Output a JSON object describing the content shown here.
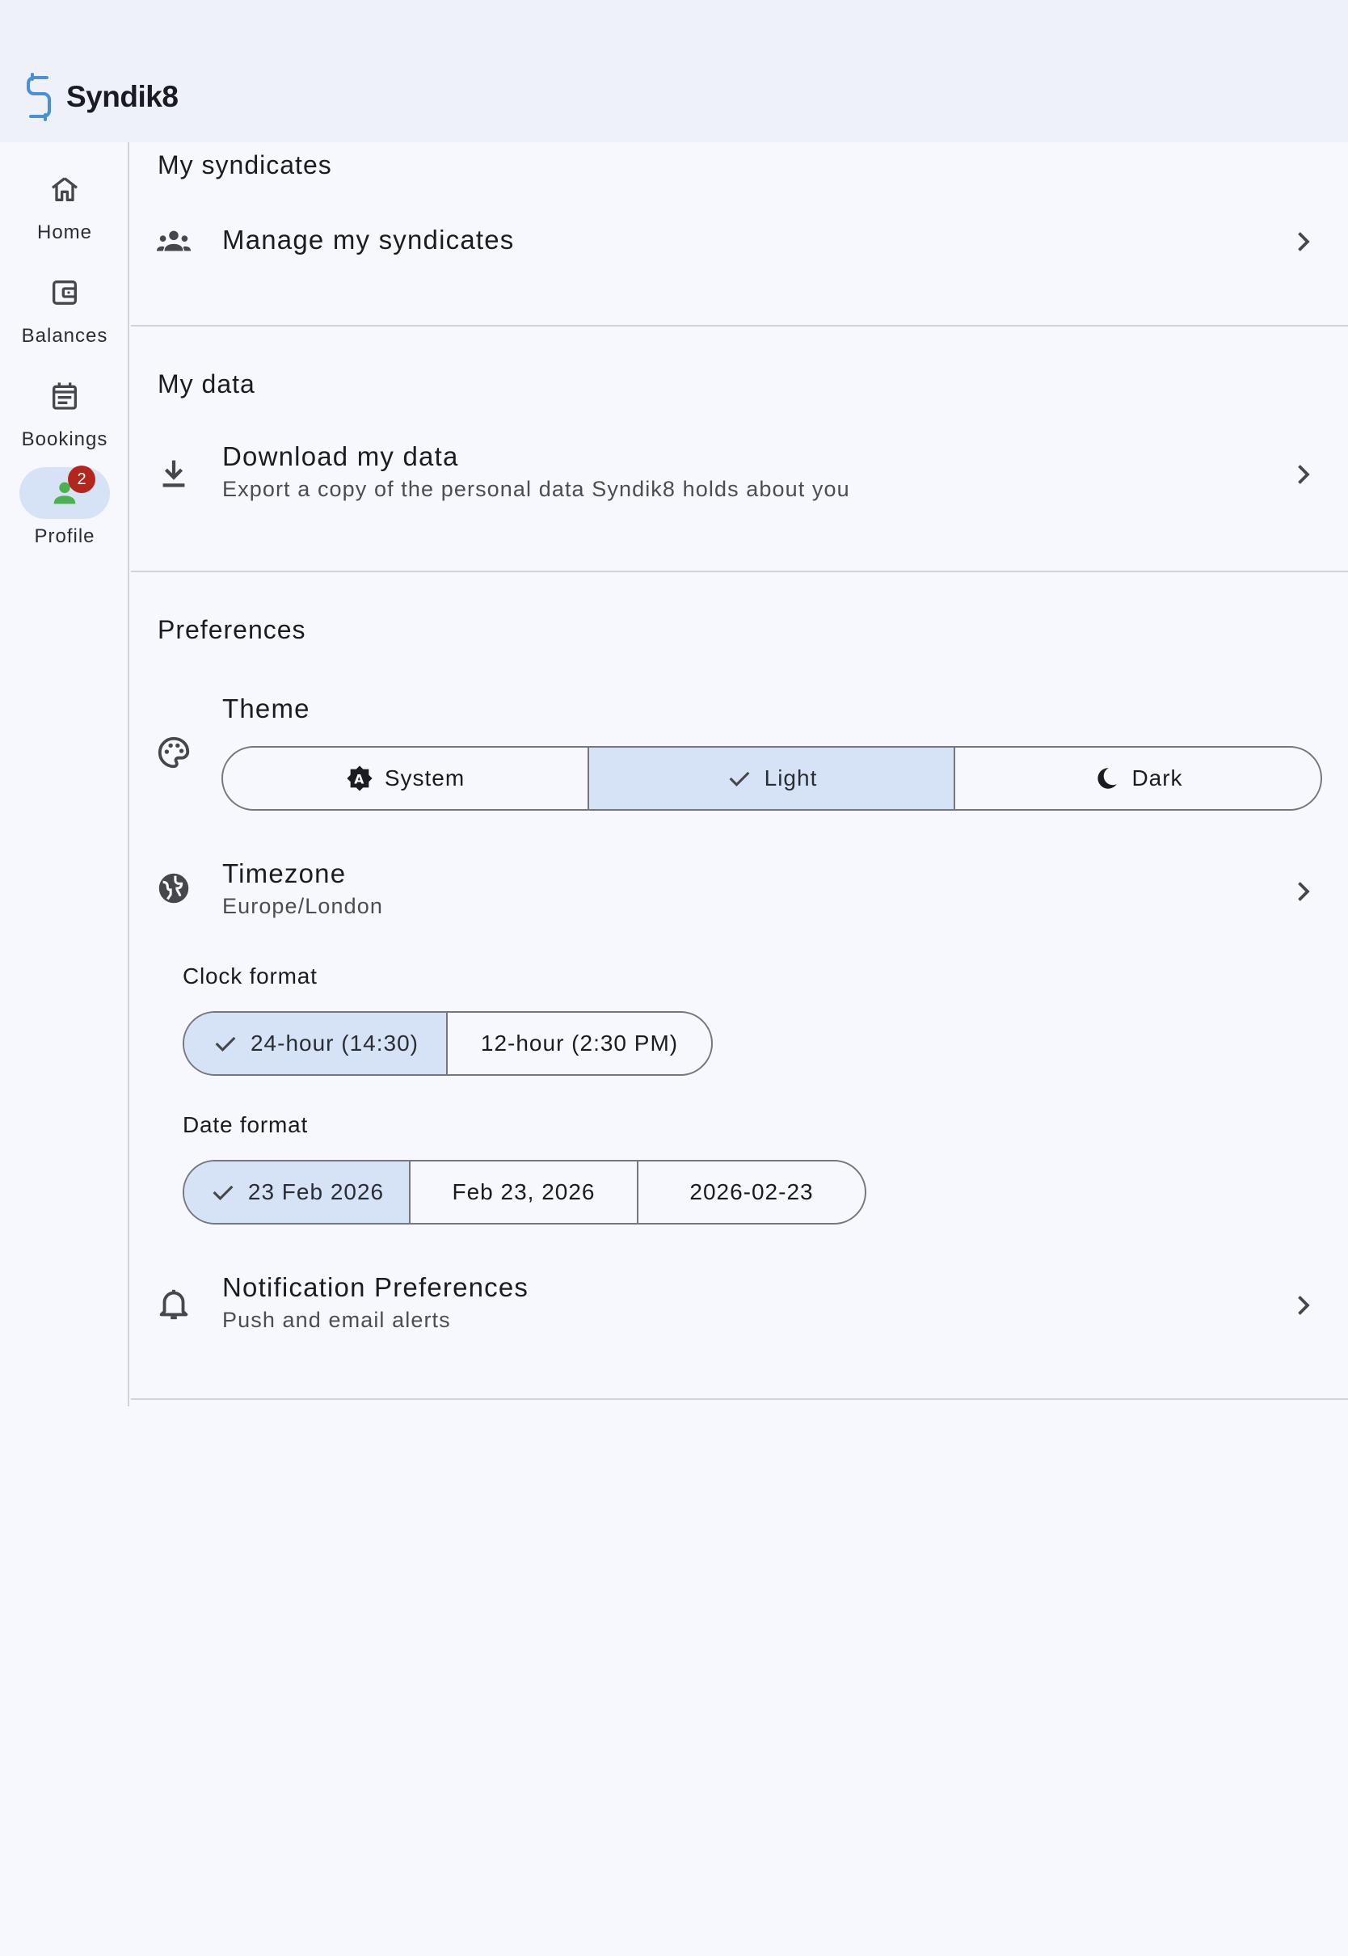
{
  "app": {
    "name": "Syndik8",
    "brand_color": "#4a90d9"
  },
  "nav": {
    "items": [
      {
        "label": "Home",
        "icon": "home-icon"
      },
      {
        "label": "Balances",
        "icon": "wallet-icon"
      },
      {
        "label": "Bookings",
        "icon": "calendar-icon"
      },
      {
        "label": "Profile",
        "icon": "person-icon",
        "active": true,
        "badge": "2"
      }
    ]
  },
  "sections": {
    "syndicates": {
      "title": "My syndicates",
      "manage": {
        "title": "Manage my syndicates",
        "icon": "group-icon"
      }
    },
    "data": {
      "title": "My data",
      "download": {
        "title": "Download my data",
        "subtitle": "Export a copy of the personal data Syndik8 holds about you",
        "icon": "download-icon"
      }
    },
    "preferences": {
      "title": "Preferences",
      "theme": {
        "label": "Theme",
        "icon": "palette-icon",
        "options": [
          "System",
          "Light",
          "Dark"
        ],
        "selected": "Light"
      },
      "timezone": {
        "title": "Timezone",
        "value": "Europe/London",
        "icon": "globe-icon"
      },
      "clock": {
        "label": "Clock format",
        "options": [
          "24-hour (14:30)",
          "12-hour (2:30 PM)"
        ],
        "selected": "24-hour (14:30)"
      },
      "date": {
        "label": "Date format",
        "options": [
          "23 Feb 2026",
          "Feb 23, 2026",
          "2026-02-23"
        ],
        "selected": "23 Feb 2026"
      },
      "notifications": {
        "title": "Notification Preferences",
        "subtitle": "Push and email alerts",
        "icon": "bell-icon"
      }
    }
  },
  "colors": {
    "selected_bg": "#d6e2f5",
    "badge": "#b3261e",
    "profile_icon": "#4caf50"
  }
}
